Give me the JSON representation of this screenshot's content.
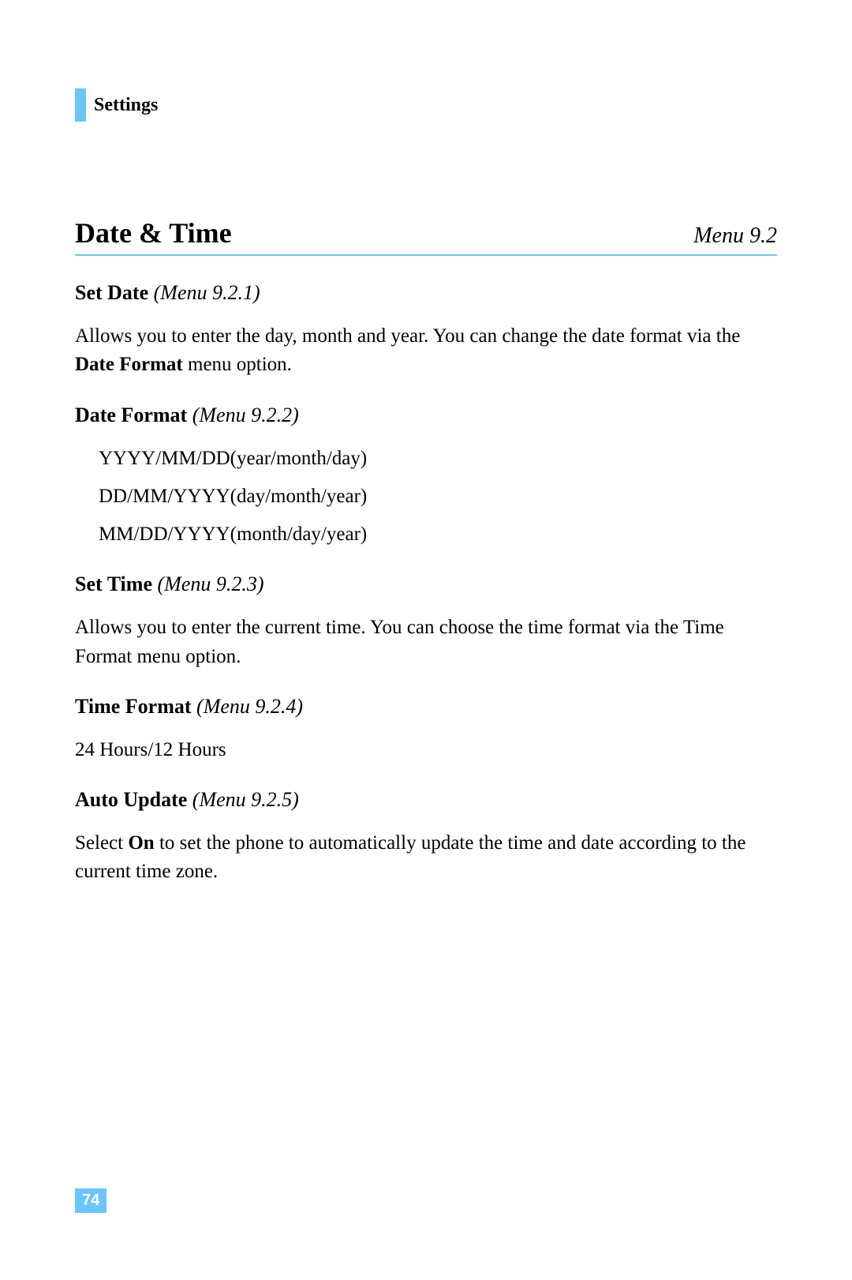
{
  "header": {
    "label": "Settings"
  },
  "title": {
    "main": "Date & Time",
    "menu": "Menu 9.2"
  },
  "sections": {
    "set_date": {
      "title": "Set Date",
      "menu": "(Menu 9.2.1)",
      "body_pre": "Allows you to enter the day, month and year. You can change the date format via the ",
      "body_bold": "Date Format",
      "body_post": " menu option."
    },
    "date_format": {
      "title": "Date Format",
      "menu": "(Menu 9.2.2)",
      "items": [
        "YYYY/MM/DD(year/month/day)",
        "DD/MM/YYYY(day/month/year)",
        "MM/DD/YYYY(month/day/year)"
      ]
    },
    "set_time": {
      "title": "Set Time",
      "menu": "(Menu 9.2.3)",
      "body": "Allows you to enter the current time. You can choose the time format via the Time Format menu option."
    },
    "time_format": {
      "title": "Time Format",
      "menu": "(Menu 9.2.4)",
      "body": "24 Hours/12 Hours"
    },
    "auto_update": {
      "title": "Auto Update",
      "menu": "(Menu 9.2.5)",
      "body_pre": "Select ",
      "body_bold": "On",
      "body_post": " to set the phone to automatically update the time and date according to the current time zone."
    }
  },
  "page_number": "74"
}
